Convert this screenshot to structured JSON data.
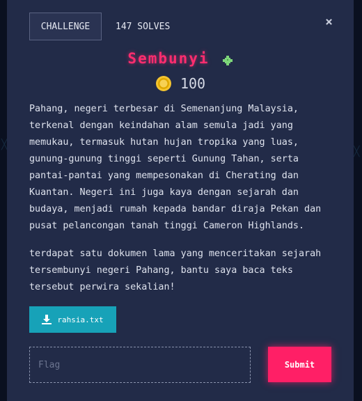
{
  "header": {
    "tab_label": "CHALLENGE",
    "solves_text": "147 SOLVES",
    "close_symbol": "×"
  },
  "challenge": {
    "title": "Sembunyi",
    "points": "100",
    "description_p1": "Pahang, negeri terbesar di Semenanjung Malaysia, terkenal dengan keindahan alam semula jadi yang memukau, termasuk hutan hujan tropika yang luas, gunung-gunung tinggi seperti Gunung Tahan, serta pantai-pantai yang mempesonakan di Cherating dan Kuantan. Negeri ini juga kaya dengan sejarah dan budaya, menjadi rumah kepada bandar diraja Pekan dan pusat pelancongan tanah tinggi Cameron Highlands.",
    "description_p2": "terdapat satu dokumen lama yang menceritakan sejarah tersembunyi negeri Pahang, bantu saya baca teks tersebut perwira sekalian!",
    "file_label": "rahsia.txt"
  },
  "form": {
    "flag_placeholder": "Flag",
    "submit_label": "Submit"
  },
  "icons": {
    "puzzle": "puzzle-piece-icon",
    "coin": "coin-icon",
    "download": "download-icon",
    "close": "close-icon"
  },
  "colors": {
    "modal_bg": "#222b48",
    "title": "#ff2d6f",
    "submit": "#ff1f66",
    "file_button": "#17a2b8",
    "puzzle": "#7ed67a",
    "coin": "#f4c430"
  }
}
